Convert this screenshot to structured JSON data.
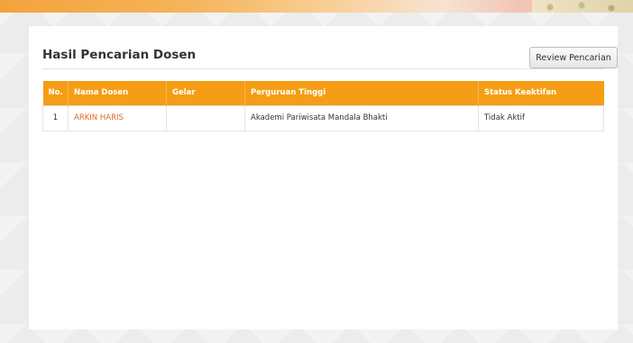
{
  "header": {
    "title": "Hasil Pencarian Dosen",
    "review_button_label": "Review Pencarian"
  },
  "table": {
    "columns": [
      "No.",
      "Nama Dosen",
      "Gelar",
      "Perguruan Tinggi",
      "Status Keaktifan"
    ],
    "rows": [
      {
        "no": "1",
        "nama": "ARKIN HARIS",
        "gelar": "",
        "perguruan_tinggi": "Akademi Pariwisata Mandala Bhakti",
        "status": "Tidak Aktif"
      }
    ]
  },
  "colors": {
    "accent": "#f59d14",
    "link": "#e0662b"
  }
}
